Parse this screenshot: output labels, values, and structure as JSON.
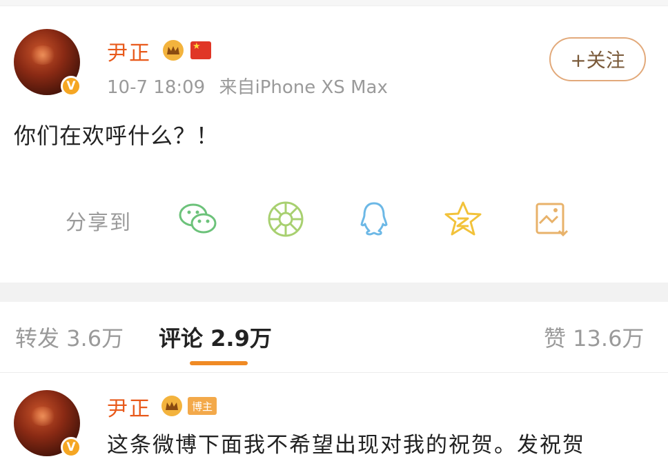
{
  "post": {
    "author": "尹正",
    "time": "10-7 18:09",
    "source": "来自iPhone XS Max",
    "follow_label": "+关注",
    "content": "你们在欢呼什么？！",
    "verified_mark": "V"
  },
  "share": {
    "label": "分享到",
    "icons": [
      "wechat-icon",
      "moments-icon",
      "qq-icon",
      "qzone-icon",
      "save-image-icon"
    ]
  },
  "tabs": {
    "repost": "转发 3.6万",
    "comment": "评论 2.9万",
    "like": "赞 13.6万"
  },
  "comment": {
    "author": "尹正",
    "badge": "博主",
    "text": "这条微博下面我不希望出现对我的祝贺。发祝贺",
    "verified_mark": "V"
  },
  "colors": {
    "name": "#e8591a",
    "accent": "#f08a24",
    "muted": "#9a9a9a"
  }
}
